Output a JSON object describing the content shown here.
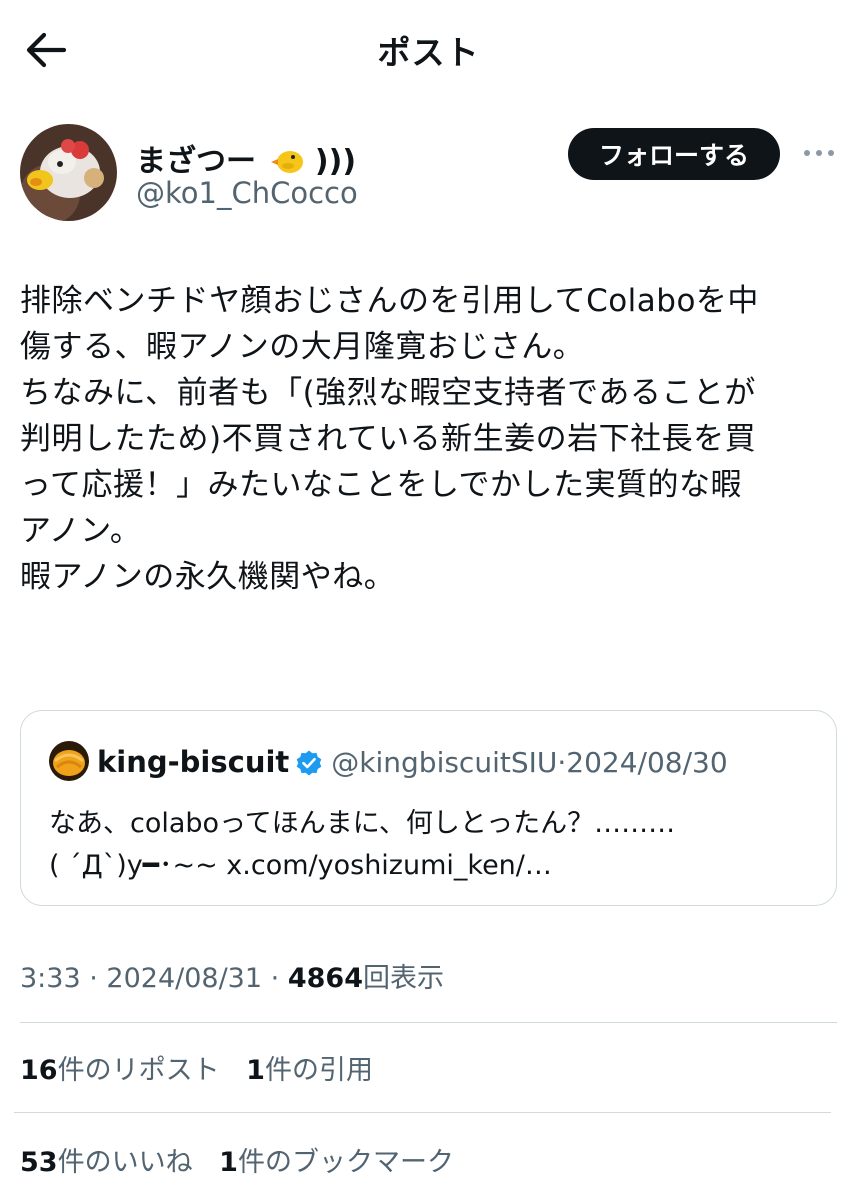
{
  "header": {
    "title": "ポスト"
  },
  "author": {
    "name": "まざつー",
    "name_suffix": ")))",
    "handle": "@ko1_ChCocco",
    "follow_label": "フォローする"
  },
  "post": {
    "lines": [
      "排除ベンチドヤ顔おじさんのを引用してColaboを中",
      "傷する、暇アノンの大月隆寛おじさん。",
      "ちなみに、前者も「(強烈な暇空支持者であることが",
      "判明したため)不買されている新生姜の岩下社長を買",
      "って応援！」みたいなことをしでかした実質的な暇",
      "アノン。",
      "暇アノンの永久機関やね。"
    ]
  },
  "quote": {
    "name": "king-biscuit",
    "handle": "@kingbiscuitSIU",
    "separator": "·",
    "date": "2024/08/30",
    "text_lines": [
      "なあ、colaboってほんまに、何しとったん？………",
      "( ´Д`)y━･~~ x.com/yoshizumi_ken/…"
    ]
  },
  "meta": {
    "time": "3:33",
    "sep1": "·",
    "date": "2024/08/31",
    "sep2": "·",
    "views": "4864",
    "views_label": "回表示"
  },
  "stats": {
    "reposts": "16",
    "reposts_label": "件のリポスト",
    "quotes": "1",
    "quotes_label": "件の引用",
    "likes": "53",
    "likes_label": "件のいいね",
    "bookmarks": "1",
    "bookmarks_label": "件のブックマーク"
  },
  "colors": {
    "text": "#0f1419",
    "secondary": "#536471",
    "border": "#cfd9de",
    "verified": "#1d9bf0"
  },
  "icons": [
    "back-arrow-icon",
    "chick-icon",
    "more-icon",
    "verified-badge-icon"
  ]
}
